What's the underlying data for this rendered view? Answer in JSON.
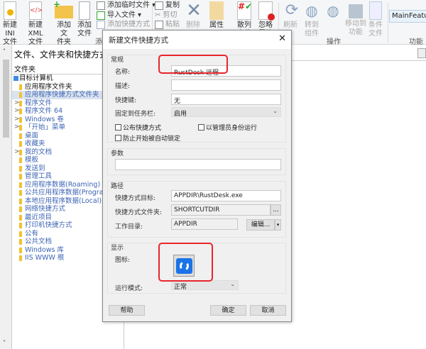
{
  "ribbon": {
    "buttons": [
      {
        "label1": "新建INI",
        "label2": "文件"
      },
      {
        "label1": "新建XML",
        "label2": "文件"
      },
      {
        "label1": "添加文",
        "label2": "件夹"
      },
      {
        "label1": "添加",
        "label2": "文件"
      }
    ],
    "small": {
      "add_temp": "添加临时文件",
      "import": "导入文件",
      "add_shortcut": "添加快捷方式",
      "copy": "复制",
      "cut": "剪切",
      "paste": "粘贴"
    },
    "delete": "删除",
    "properties": "属性",
    "hash": "散列文件",
    "ignore": "忽略属性",
    "refresh": "刷新",
    "goto1": "转到",
    "goto2": "组件",
    "move1": "移动到",
    "move2": "功能",
    "cond1": "条件",
    "cond2": "文件",
    "group_add": "添加",
    "group_ops": "操作",
    "group_feature": "功能",
    "feature_value": "MainFeature"
  },
  "tree": {
    "title": "文件、文件夹和快捷方式",
    "header": "文件夹",
    "root": "目标计算机",
    "items": [
      {
        "label": "应用程序文件夹",
        "expand": ""
      },
      {
        "label": "应用程序快捷方式文件夹",
        "expand": ""
      },
      {
        "label": "程序文件",
        "expand": ">"
      },
      {
        "label": "程序文件 64",
        "expand": ">"
      },
      {
        "label": "Windows 卷",
        "expand": ">"
      },
      {
        "label": "「开始」菜单",
        "expand": ">"
      },
      {
        "label": "桌面",
        "expand": ""
      },
      {
        "label": "收藏夹",
        "expand": ""
      },
      {
        "label": "我的文档",
        "expand": ">"
      },
      {
        "label": "模板",
        "expand": ""
      },
      {
        "label": "发送到",
        "expand": ""
      },
      {
        "label": "管理工具",
        "expand": ""
      },
      {
        "label": "应用程序数据(Roaming)",
        "expand": ""
      },
      {
        "label": "公共应用程序数据(ProgramData)",
        "expand": ""
      },
      {
        "label": "本地应用程序数据(Local)",
        "expand": ""
      },
      {
        "label": "网络快捷方式",
        "expand": ""
      },
      {
        "label": "最近项目",
        "expand": ""
      },
      {
        "label": "打印机快捷方式",
        "expand": ""
      },
      {
        "label": "公有",
        "expand": ""
      },
      {
        "label": "公共文档",
        "expand": ""
      },
      {
        "label": "Windows 库",
        "expand": ""
      },
      {
        "label": "IIS WWW 根",
        "expand": ""
      }
    ]
  },
  "dialog": {
    "title": "新建文件快捷方式",
    "close": "✕",
    "general": {
      "legend": "常规",
      "name_label": "名称:",
      "name_value": "RustDesk 远程",
      "desc_label": "描述:",
      "desc_value": "",
      "hotkey_label": "快捷键:",
      "hotkey_value": "无",
      "pin_label": "固定到任务栏:",
      "pin_value": "启用",
      "cb_publish": "公布快捷方式",
      "cb_admin": "以管理员身份运行",
      "cb_prevent": "防止开始被自动锁定"
    },
    "args": {
      "legend": "参数",
      "value": ""
    },
    "path": {
      "legend": "路径",
      "target_label": "快捷方式目标:",
      "target_value": "APPDIR\\RustDesk.exe",
      "folder_label": "快捷方式文件夹:",
      "folder_value": "SHORTCUTDIR",
      "browse": "...",
      "workdir_label": "工作目录:",
      "workdir_value": "APPDIR",
      "edit": "编辑...",
      "edit_arrow": "▾"
    },
    "display": {
      "legend": "显示",
      "icon_label": "图标:",
      "runmode_label": "运行模式:",
      "runmode_value": "正常"
    },
    "help": "帮助",
    "ok": "确定",
    "cancel": "取消"
  },
  "colors": {
    "highlight": "#e8262b",
    "icon": "#1a73e8"
  }
}
